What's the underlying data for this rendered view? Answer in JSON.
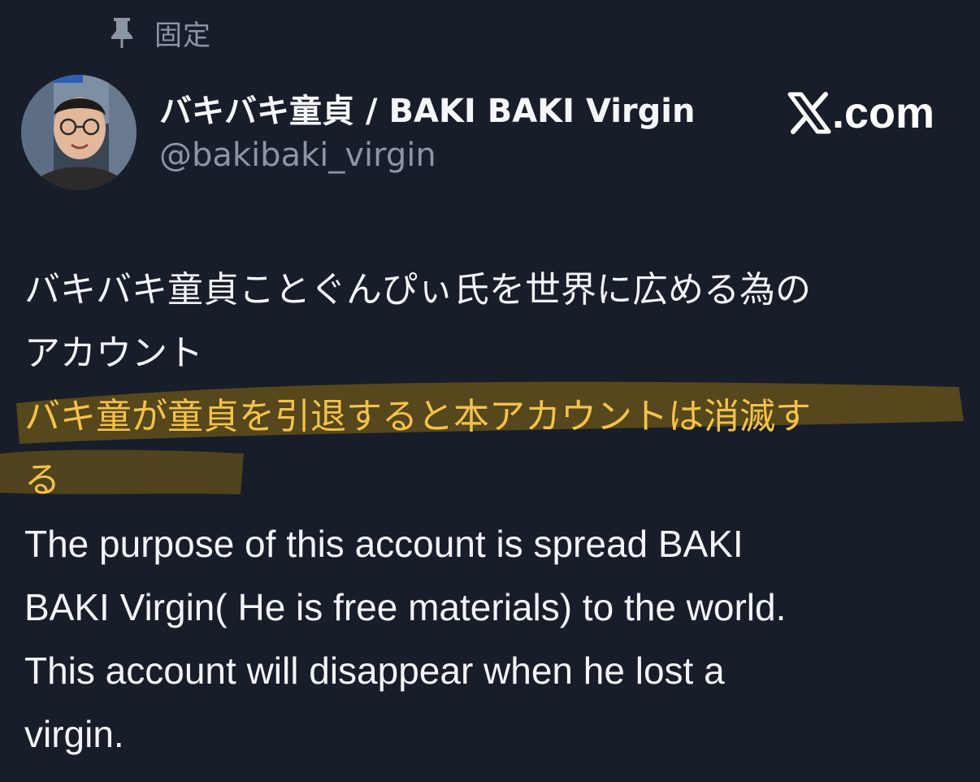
{
  "pinned": {
    "label": "固定",
    "icon": "pin-icon"
  },
  "profile": {
    "display_name": "バキバキ童貞 / BAKI BAKI Virgin",
    "handle": "@bakibaki_virgin",
    "avatar": "avatar"
  },
  "watermark": {
    "icon": "x-logo-icon",
    "text": ".com"
  },
  "bio": {
    "lines": [
      "バキバキ童貞ことぐんぴぃ氏を世界に広める為の",
      "アカウント",
      "バキ童が童貞を引退すると本アカウントは消滅す",
      "る",
      "The purpose of this account is spread BAKI",
      "BAKI Virgin( He is free materials) to the world.",
      "This account will disappear when he lost a",
      "virgin."
    ]
  },
  "colors": {
    "background": "#171d29",
    "primary_text": "#f2f4f7",
    "secondary_text": "#8b95a3",
    "highlight_text": "#f4c24a",
    "highlight_marker": "#c99a1a"
  }
}
